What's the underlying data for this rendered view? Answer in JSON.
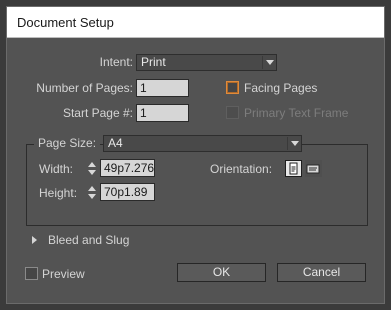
{
  "window": {
    "title": "Document Setup"
  },
  "intent": {
    "label": "Intent:",
    "value": "Print"
  },
  "number_of_pages": {
    "label": "Number of Pages:",
    "value": "1"
  },
  "start_page": {
    "label": "Start Page #:",
    "value": "1"
  },
  "facing_pages": {
    "label": "Facing Pages",
    "checked": false
  },
  "primary_text_frame": {
    "label": "Primary Text Frame",
    "checked": false,
    "enabled": false
  },
  "page_size": {
    "label": "Page Size:",
    "value": "A4"
  },
  "width": {
    "label": "Width:",
    "value": "49p7.276"
  },
  "height": {
    "label": "Height:",
    "value": "70p1.89"
  },
  "orientation": {
    "label": "Orientation:",
    "selected": "portrait",
    "icons": [
      "portrait-page-icon",
      "landscape-page-icon"
    ]
  },
  "bleed_and_slug": {
    "label": "Bleed and Slug",
    "expanded": false
  },
  "preview": {
    "label": "Preview",
    "checked": false
  },
  "buttons": {
    "ok": "OK",
    "cancel": "Cancel"
  },
  "colors": {
    "panel": "#535353",
    "field": "#d6d6d6",
    "focus_accent": "#e08a3a"
  }
}
